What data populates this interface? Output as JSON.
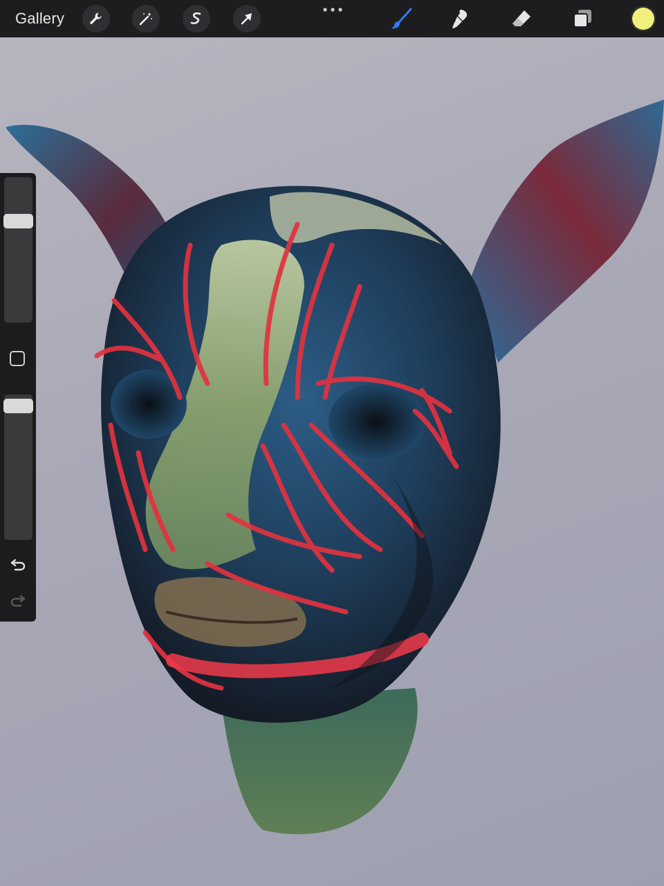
{
  "toolbar": {
    "gallery_label": "Gallery",
    "left_tools": [
      "wrench-icon",
      "magic-wand-icon",
      "selection-s-icon",
      "transform-arrow-icon"
    ],
    "more_icon": "ellipsis-icon",
    "right_tools": [
      "brush-icon",
      "smudge-icon",
      "eraser-icon",
      "layers-icon"
    ],
    "active_tool": "brush",
    "active_color": "#f1ef7e",
    "accent_color": "#2f7cf6"
  },
  "sidebar": {
    "brush_size_level": 0.72,
    "opacity_level": 0.97,
    "modify_button": "square-icon",
    "undo_icon": "undo-icon",
    "redo_icon": "redo-icon"
  },
  "canvas": {
    "subject": "3d-sculpted-creature-head"
  }
}
